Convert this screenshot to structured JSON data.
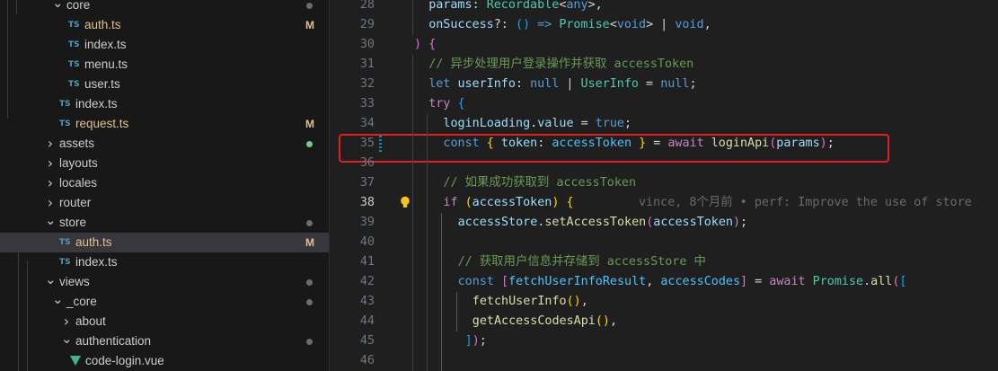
{
  "explorer": {
    "items": [
      {
        "label": "core",
        "type": "folder",
        "open": true,
        "depth": 2,
        "dot": true
      },
      {
        "label": "auth.ts",
        "type": "ts",
        "depth": 3,
        "badge": "M"
      },
      {
        "label": "index.ts",
        "type": "ts",
        "depth": 3
      },
      {
        "label": "menu.ts",
        "type": "ts",
        "depth": 3
      },
      {
        "label": "user.ts",
        "type": "ts",
        "depth": 3
      },
      {
        "label": "index.ts",
        "type": "ts",
        "depth": 2
      },
      {
        "label": "request.ts",
        "type": "ts",
        "depth": 2,
        "badge": "M"
      },
      {
        "label": "assets",
        "type": "folder",
        "open": false,
        "depth": 1,
        "dot": true,
        "green": true
      },
      {
        "label": "layouts",
        "type": "folder",
        "open": false,
        "depth": 1
      },
      {
        "label": "locales",
        "type": "folder",
        "open": false,
        "depth": 1
      },
      {
        "label": "router",
        "type": "folder",
        "open": false,
        "depth": 1
      },
      {
        "label": "store",
        "type": "folder",
        "open": true,
        "depth": 1,
        "dot": true
      },
      {
        "label": "auth.ts",
        "type": "ts",
        "depth": 2,
        "badge": "M",
        "selected": true
      },
      {
        "label": "index.ts",
        "type": "ts",
        "depth": 2
      },
      {
        "label": "views",
        "type": "folder",
        "open": true,
        "depth": 1,
        "dot": true
      },
      {
        "label": "_core",
        "type": "folder",
        "open": true,
        "depth": 2,
        "dot": true
      },
      {
        "label": "about",
        "type": "folder",
        "open": false,
        "depth": 3
      },
      {
        "label": "authentication",
        "type": "folder",
        "open": true,
        "depth": 3,
        "dot": true
      },
      {
        "label": "code-login.vue",
        "type": "vue",
        "depth": 4
      }
    ],
    "ts_icon_text": "TS"
  },
  "editor": {
    "active_line": 38,
    "lines": [
      {
        "n": "28",
        "indent": 1,
        "toks": [
          [
            "var",
            "params"
          ],
          [
            "p",
            ": "
          ],
          [
            "type",
            "Recordable"
          ],
          [
            "p",
            "<"
          ],
          [
            "kw",
            "any"
          ],
          [
            "p",
            ">,"
          ]
        ]
      },
      {
        "n": "29",
        "indent": 1,
        "toks": [
          [
            "var",
            "onSuccess"
          ],
          [
            "p",
            "?: "
          ],
          [
            "b3",
            "()"
          ],
          [
            "p",
            " "
          ],
          [
            "kw",
            "=>"
          ],
          [
            "p",
            " "
          ],
          [
            "type",
            "Promise"
          ],
          [
            "p",
            "<"
          ],
          [
            "kw",
            "void"
          ],
          [
            "p",
            "> | "
          ],
          [
            "kw",
            "void"
          ],
          [
            "p",
            ","
          ]
        ]
      },
      {
        "n": "30",
        "indent": 0,
        "toks": [
          [
            "b2",
            ")"
          ],
          [
            "p",
            " "
          ],
          [
            "b2",
            "{"
          ]
        ]
      },
      {
        "n": "31",
        "indent": 1,
        "toks": [
          [
            "cm",
            "// 异步处理用户登录操作并获取 accessToken"
          ]
        ]
      },
      {
        "n": "32",
        "indent": 1,
        "toks": [
          [
            "kw",
            "let"
          ],
          [
            "p",
            " "
          ],
          [
            "var",
            "userInfo"
          ],
          [
            "p",
            ": "
          ],
          [
            "kw",
            "null"
          ],
          [
            "p",
            " | "
          ],
          [
            "type",
            "UserInfo"
          ],
          [
            "p",
            " = "
          ],
          [
            "kw",
            "null"
          ],
          [
            "p",
            ";"
          ]
        ]
      },
      {
        "n": "33",
        "indent": 1,
        "toks": [
          [
            "ctl",
            "try"
          ],
          [
            "p",
            " "
          ],
          [
            "b3",
            "{"
          ]
        ]
      },
      {
        "n": "34",
        "indent": 2,
        "toks": [
          [
            "var",
            "loginLoading"
          ],
          [
            "p",
            "."
          ],
          [
            "var",
            "value"
          ],
          [
            "p",
            " = "
          ],
          [
            "kw",
            "true"
          ],
          [
            "p",
            ";"
          ]
        ]
      },
      {
        "n": "35",
        "indent": 2,
        "toks": [
          [
            "kw",
            "const"
          ],
          [
            "p",
            " "
          ],
          [
            "b1",
            "{"
          ],
          [
            "p",
            " "
          ],
          [
            "var",
            "token"
          ],
          [
            "p",
            ": "
          ],
          [
            "const",
            "accessToken"
          ],
          [
            "p",
            " "
          ],
          [
            "b1",
            "}"
          ],
          [
            "p",
            " = "
          ],
          [
            "ctl",
            "await"
          ],
          [
            "p",
            " "
          ],
          [
            "fn",
            "loginApi"
          ],
          [
            "b2",
            "("
          ],
          [
            "var",
            "params"
          ],
          [
            "b2",
            ")"
          ],
          [
            "p",
            ";"
          ]
        ]
      },
      {
        "n": "36",
        "indent": 2,
        "toks": []
      },
      {
        "n": "37",
        "indent": 2,
        "toks": [
          [
            "cm",
            "// 如果成功获取到 accessToken"
          ]
        ]
      },
      {
        "n": "38",
        "indent": 2,
        "toks": [
          [
            "ctl",
            "if"
          ],
          [
            "p",
            " "
          ],
          [
            "b1",
            "("
          ],
          [
            "var",
            "accessToken"
          ],
          [
            "b1",
            ")"
          ],
          [
            "p",
            " "
          ],
          [
            "b1",
            "{"
          ]
        ]
      },
      {
        "n": "39",
        "indent": 3,
        "toks": [
          [
            "var",
            "accessStore"
          ],
          [
            "p",
            "."
          ],
          [
            "fn",
            "setAccessToken"
          ],
          [
            "b2",
            "("
          ],
          [
            "var",
            "accessToken"
          ],
          [
            "b2",
            ")"
          ],
          [
            "p",
            ";"
          ]
        ]
      },
      {
        "n": "40",
        "indent": 3,
        "toks": []
      },
      {
        "n": "41",
        "indent": 3,
        "toks": [
          [
            "cm",
            "// 获取用户信息并存储到 accessStore 中"
          ]
        ]
      },
      {
        "n": "42",
        "indent": 3,
        "toks": [
          [
            "kw",
            "const"
          ],
          [
            "p",
            " "
          ],
          [
            "b2",
            "["
          ],
          [
            "const",
            "fetchUserInfoResult"
          ],
          [
            "p",
            ", "
          ],
          [
            "const",
            "accessCodes"
          ],
          [
            "b2",
            "]"
          ],
          [
            "p",
            " = "
          ],
          [
            "ctl",
            "await"
          ],
          [
            "p",
            " "
          ],
          [
            "type",
            "Promise"
          ],
          [
            "p",
            "."
          ],
          [
            "fn",
            "all"
          ],
          [
            "b2",
            "("
          ],
          [
            "b3",
            "["
          ]
        ]
      },
      {
        "n": "43",
        "indent": 4,
        "toks": [
          [
            "fn",
            "fetchUserInfo"
          ],
          [
            "b1",
            "()"
          ],
          [
            "p",
            ","
          ]
        ]
      },
      {
        "n": "44",
        "indent": 4,
        "toks": [
          [
            "fn",
            "getAccessCodesApi"
          ],
          [
            "b1",
            "()"
          ],
          [
            "p",
            ","
          ]
        ]
      },
      {
        "n": "45",
        "indent": 3,
        "toks": [
          [
            "p",
            " "
          ],
          [
            "b3",
            "]"
          ],
          [
            "b2",
            ")"
          ],
          [
            "p",
            ";"
          ]
        ]
      },
      {
        "n": "46",
        "indent": 3,
        "toks": []
      }
    ],
    "blame": "vince, 8个月前 • perf: Improve the use of store"
  },
  "colors": {
    "highlight_box": "#e02020"
  }
}
